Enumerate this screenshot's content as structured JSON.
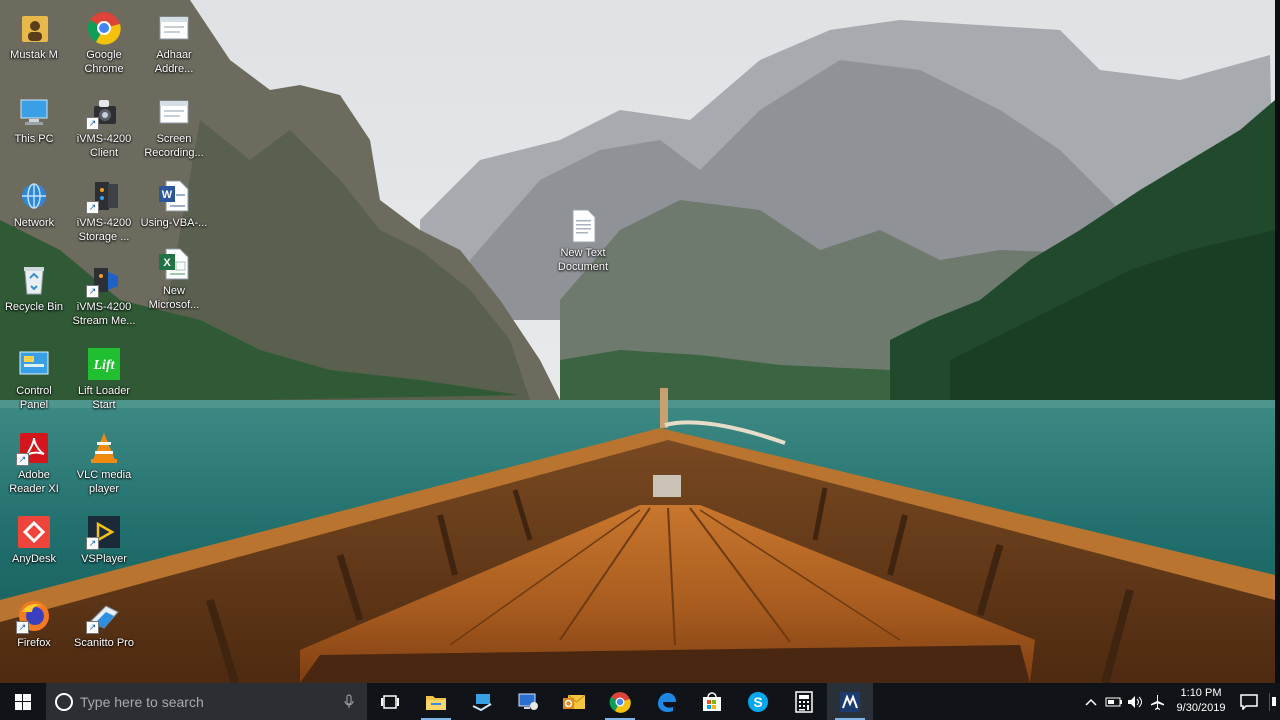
{
  "desktop": {
    "icons": [
      {
        "label": "Mustak M",
        "icon": "user-folder-icon"
      },
      {
        "label": "Google\nChrome",
        "icon": "chrome-icon"
      },
      {
        "label": "Adhaar\nAddre...",
        "icon": "window-icon"
      },
      {
        "label": "This PC",
        "icon": "computer-icon"
      },
      {
        "label": "iVMS-4200\nClient",
        "icon": "camera-icon"
      },
      {
        "label": "Screen\nRecording...",
        "icon": "window-icon"
      },
      {
        "label": "Network",
        "icon": "network-icon"
      },
      {
        "label": "iVMS-4200\nStorage ...",
        "icon": "storage-icon"
      },
      {
        "label": "Using-VBA-...",
        "icon": "word-doc-icon"
      },
      {
        "label": "Recycle Bin",
        "icon": "recycle-bin-icon"
      },
      {
        "label": "iVMS-4200\nStream Me...",
        "icon": "stream-icon"
      },
      {
        "label": "New\nMicrosof...",
        "icon": "excel-doc-icon"
      },
      {
        "label": "Control\nPanel",
        "icon": "control-panel-icon"
      },
      {
        "label": "Lift Loader\nStart",
        "icon": "lift-loader-icon"
      },
      {
        "label": "Adobe\nReader XI",
        "icon": "adobe-reader-icon"
      },
      {
        "label": "VLC media\nplayer",
        "icon": "vlc-icon"
      },
      {
        "label": "AnyDesk",
        "icon": "anydesk-icon"
      },
      {
        "label": "VSPlayer",
        "icon": "vsplayer-icon"
      },
      {
        "label": "Firefox",
        "icon": "firefox-icon"
      },
      {
        "label": "Scanitto Pro",
        "icon": "scanner-icon"
      },
      {
        "label": "New Text\nDocument",
        "icon": "text-document-icon"
      }
    ]
  },
  "taskbar": {
    "search_placeholder": "Type here to search",
    "time": "1:10 PM",
    "date": "9/30/2019",
    "pinned": [
      "task-view",
      "file-explorer",
      "network-share",
      "remote-desktop",
      "outlook",
      "chrome",
      "edge",
      "store",
      "skype",
      "calculator",
      "app-m"
    ]
  },
  "colors": {
    "taskbar_bg": "#101418",
    "search_bg": "#2b2f33",
    "active_indicator": "#7fb2e5"
  }
}
